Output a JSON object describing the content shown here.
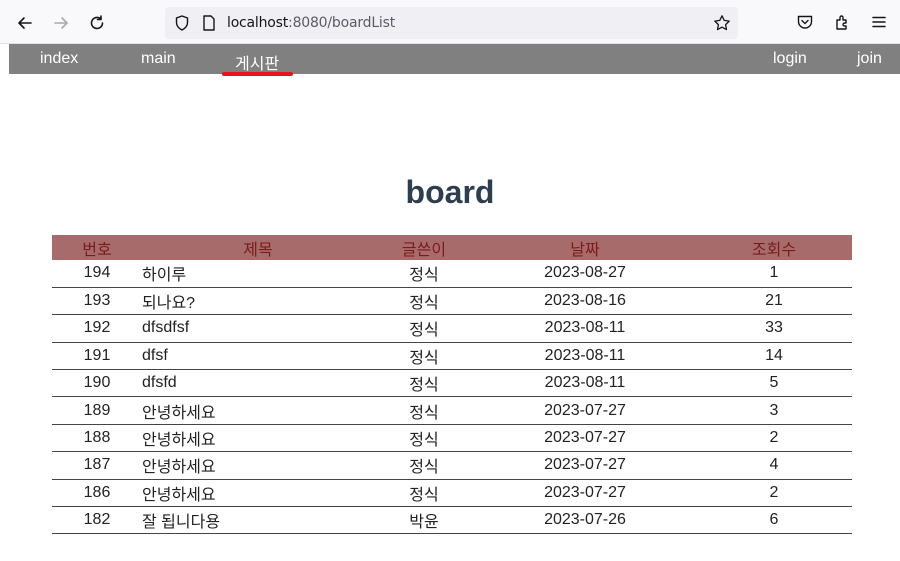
{
  "browser": {
    "url_host": "localhost",
    "url_rest": ":8080/boardList"
  },
  "nav": {
    "left": [
      "index",
      "main",
      "게시판"
    ],
    "right": [
      "login",
      "join"
    ],
    "active": "게시판"
  },
  "page": {
    "title": "board"
  },
  "table": {
    "headers": [
      "번호",
      "제목",
      "글쓴이",
      "날짜",
      "조회수"
    ],
    "rows": [
      {
        "num": "194",
        "title": "하이루",
        "writer": "정식",
        "date": "2023-08-27",
        "views": "1"
      },
      {
        "num": "193",
        "title": "되나요?",
        "writer": "정식",
        "date": "2023-08-16",
        "views": "21"
      },
      {
        "num": "192",
        "title": "dfsdfsf",
        "writer": "정식",
        "date": "2023-08-11",
        "views": "33"
      },
      {
        "num": "191",
        "title": "dfsf",
        "writer": "정식",
        "date": "2023-08-11",
        "views": "14"
      },
      {
        "num": "190",
        "title": "dfsfd",
        "writer": "정식",
        "date": "2023-08-11",
        "views": "5"
      },
      {
        "num": "189",
        "title": "안녕하세요",
        "writer": "정식",
        "date": "2023-07-27",
        "views": "3"
      },
      {
        "num": "188",
        "title": "안녕하세요",
        "writer": "정식",
        "date": "2023-07-27",
        "views": "2"
      },
      {
        "num": "187",
        "title": "안녕하세요",
        "writer": "정식",
        "date": "2023-07-27",
        "views": "4"
      },
      {
        "num": "186",
        "title": "안녕하세요",
        "writer": "정식",
        "date": "2023-07-27",
        "views": "2"
      },
      {
        "num": "182",
        "title": "잘 됩니다용",
        "writer": "박윤",
        "date": "2023-07-26",
        "views": "6"
      }
    ]
  },
  "colors": {
    "nav_bg": "#808080",
    "active_underline": "#e8141c",
    "header_bg": "#a86b6b",
    "title": "#2d3e50"
  }
}
